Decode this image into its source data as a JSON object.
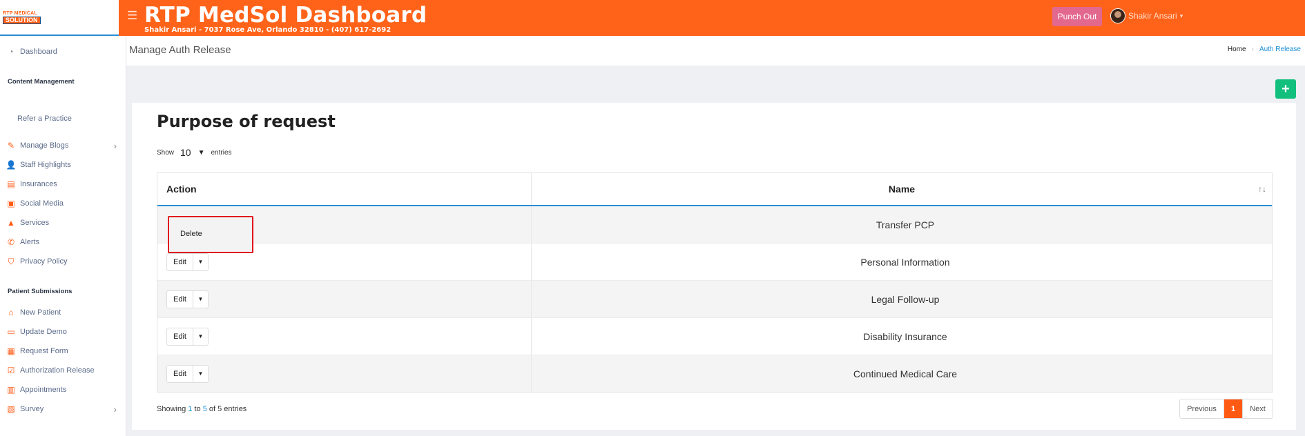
{
  "header": {
    "logo_top": "RTP MEDICAL",
    "logo_bottom": "SOLUTION",
    "title": "RTP MedSol Dashboard",
    "subtitle": "Shakir Ansari - 7037 Rose Ave, Orlando 32810 - (407) 617-2692",
    "punch_out_label": "Punch Out",
    "user_name": "Shakir Ansari",
    "accent_color": "#ff6319"
  },
  "sidebar": {
    "dashboard": "Dashboard",
    "content_heading": "Content Management",
    "refer": "Refer a Practice",
    "content_items": [
      {
        "label": "Manage Blogs",
        "icon": "blog-icon"
      },
      {
        "label": "Staff Highlights",
        "icon": "staff-icon"
      },
      {
        "label": "Insurances",
        "icon": "insurance-icon"
      },
      {
        "label": "Social Media",
        "icon": "social-media-icon"
      },
      {
        "label": "Services",
        "icon": "services-icon"
      },
      {
        "label": "Alerts",
        "icon": "phone-icon"
      },
      {
        "label": "Privacy Policy",
        "icon": "shield-icon"
      }
    ],
    "patient_heading": "Patient Submissions",
    "patient_items": [
      {
        "label": "New Patient",
        "icon": "home-icon"
      },
      {
        "label": "Update Demo",
        "icon": "id-card-icon"
      },
      {
        "label": "Request Form",
        "icon": "form-icon"
      },
      {
        "label": "Authorization Release",
        "icon": "checklist-icon"
      },
      {
        "label": "Appointments",
        "icon": "calendar-icon"
      },
      {
        "label": "Survey",
        "icon": "chart-icon"
      }
    ]
  },
  "page": {
    "title": "Manage Auth Release",
    "breadcrumb_home": "Home",
    "breadcrumb_current": "Auth Release",
    "add_label": "+"
  },
  "table": {
    "title": "Purpose of request",
    "show_label": "Show",
    "entries_value": "10",
    "entries_label": "entries",
    "col_action": "Action",
    "col_name": "Name",
    "rows": [
      {
        "name": "Transfer PCP"
      },
      {
        "name": "Personal Information"
      },
      {
        "name": "Legal Follow-up"
      },
      {
        "name": "Disability Insurance"
      },
      {
        "name": "Continued Medical Care"
      }
    ],
    "edit_label": "Edit",
    "dropdown_delete": "Delete",
    "info_prefix": "Showing",
    "info_from": "1",
    "info_to_word": "to",
    "info_to": "5",
    "info_of": "of 5 entries",
    "pager_previous": "Previous",
    "pager_current": "1",
    "pager_next": "Next"
  }
}
